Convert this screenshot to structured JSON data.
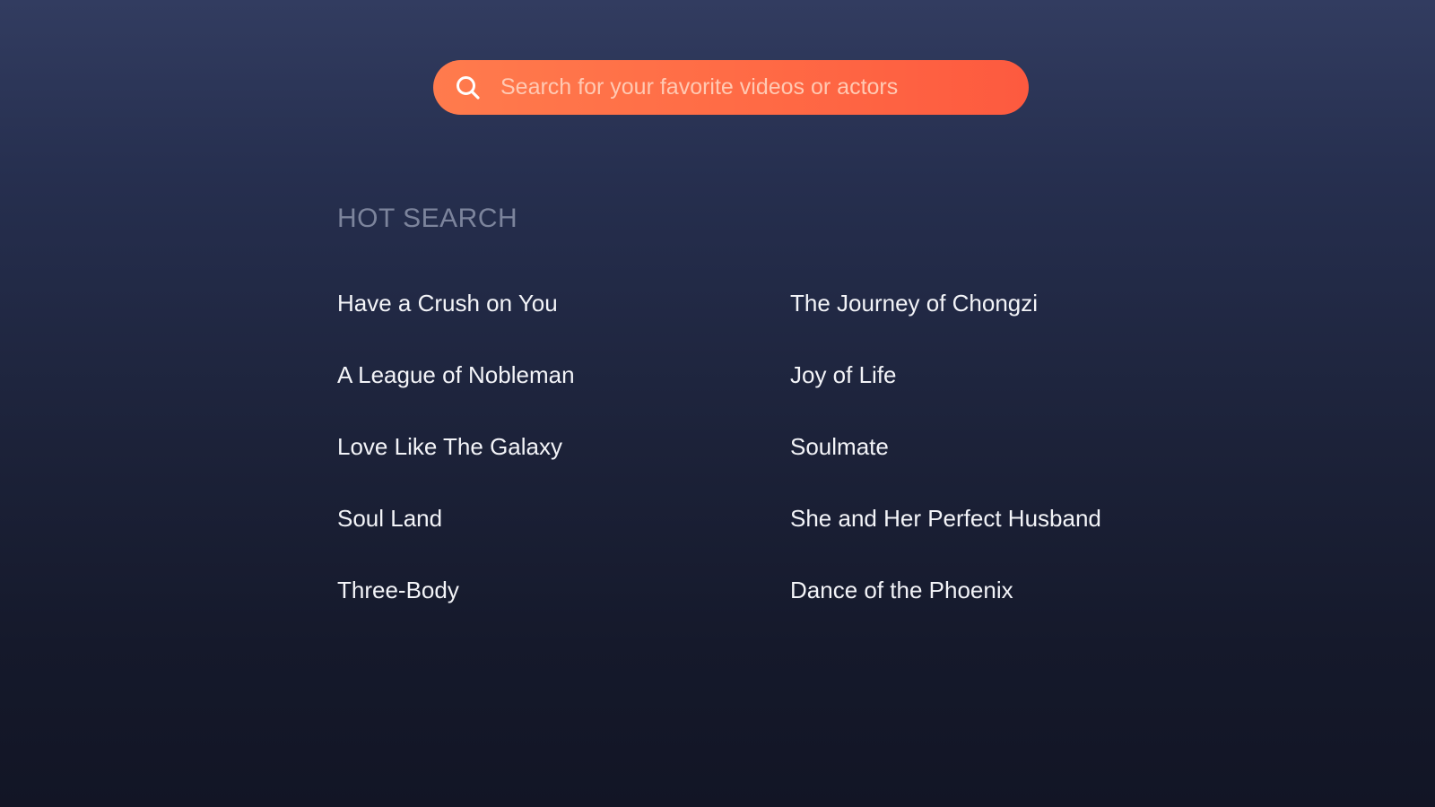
{
  "search": {
    "placeholder": "Search for your favorite videos or actors",
    "icon": "search-icon",
    "accent_color": "#ff6a45"
  },
  "hot_search": {
    "title": "HOT SEARCH",
    "items": [
      "Have a Crush on You",
      "The Journey of Chongzi",
      "A League of Nobleman",
      "Joy of Life",
      "Love Like The Galaxy",
      "Soulmate",
      "Soul Land",
      "She and Her Perfect Husband",
      "Three-Body",
      "Dance of the Phoenix"
    ]
  }
}
